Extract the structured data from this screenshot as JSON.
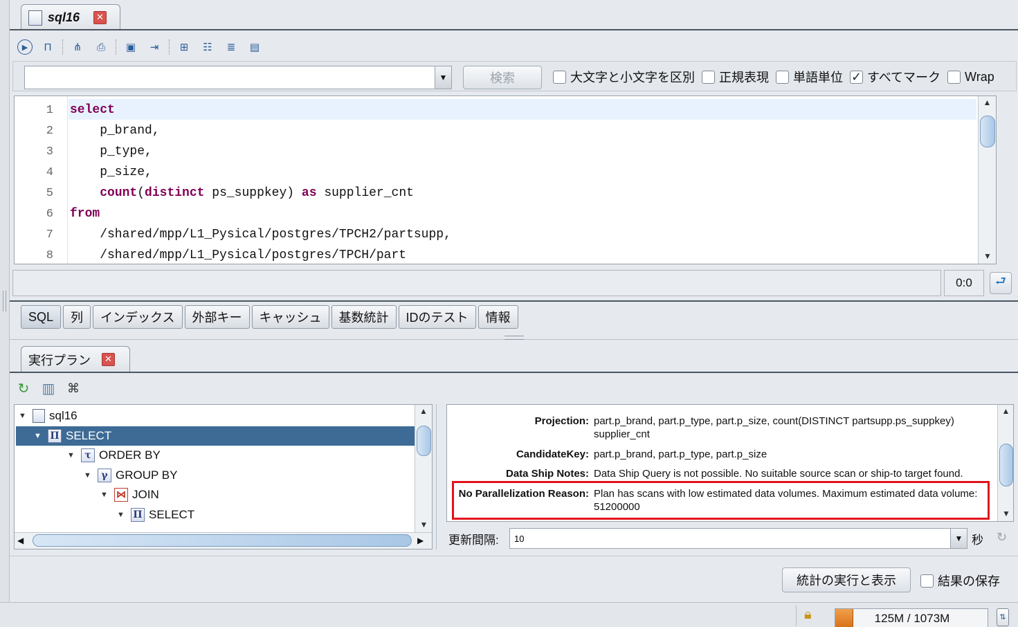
{
  "editor_tab": {
    "title": "sql16",
    "close": "✕"
  },
  "toolbar": {
    "icons": [
      "execute-icon",
      "explain-plan-icon",
      "query-tree-icon",
      "print-icon",
      "save-icon",
      "import-icon",
      "add-row-icon",
      "format-icon",
      "indent-icon",
      "document-icon"
    ]
  },
  "search": {
    "value": "",
    "search_button": "検索",
    "options": [
      {
        "label": "大文字と小文字を区別",
        "checked": false
      },
      {
        "label": "正規表現",
        "checked": false
      },
      {
        "label": "単語単位",
        "checked": false
      },
      {
        "label": "すべてマーク",
        "checked": true
      },
      {
        "label": "Wrap",
        "checked": false
      }
    ],
    "check_mark": "✓"
  },
  "code": {
    "lines": [
      {
        "n": "1",
        "kw": "select",
        "rest": ""
      },
      {
        "n": "2",
        "kw": "",
        "rest": "    p_brand,"
      },
      {
        "n": "3",
        "kw": "",
        "rest": "    p_type,"
      },
      {
        "n": "4",
        "kw": "",
        "rest": "    p_size,"
      },
      {
        "n": "5",
        "kw": "",
        "rest": ""
      },
      {
        "n": "6",
        "kw": "from",
        "rest": ""
      },
      {
        "n": "7",
        "kw": "",
        "rest": "    /shared/mpp/L1_Pysical/postgres/TPCH2/partsupp,"
      },
      {
        "n": "8",
        "kw": "",
        "rest": "    /shared/mpp/L1_Pysical/postgres/TPCH/part"
      }
    ],
    "line5": {
      "indent": "    ",
      "kw1": "count",
      "t1": "(",
      "kw2": "distinct",
      "t2": " ps_suppkey) ",
      "kw3": "as",
      "t3": " supplier_cnt"
    }
  },
  "cursor_position": "0:0",
  "bottom_tabs": [
    "SQL",
    "列",
    "インデックス",
    "外部キー",
    "キャッシュ",
    "基数統計",
    "IDのテスト",
    "情報"
  ],
  "plan_tab": {
    "title": "実行プラン",
    "close": "✕"
  },
  "tree": {
    "nodes": [
      {
        "label": "sql16",
        "icon": "document-icon",
        "glyph": ""
      },
      {
        "label": "SELECT",
        "icon": "select-icon",
        "glyph": "Π"
      },
      {
        "label": "ORDER BY",
        "icon": "order-by-icon",
        "glyph": "τ"
      },
      {
        "label": "GROUP BY",
        "icon": "group-by-icon",
        "glyph": "γ"
      },
      {
        "label": "JOIN",
        "icon": "join-icon",
        "glyph": "⋈"
      },
      {
        "label": "SELECT",
        "icon": "select-icon",
        "glyph": "Π"
      }
    ]
  },
  "properties": [
    {
      "label": "Projection:",
      "value": "part.p_brand, part.p_type, part.p_size, count(DISTINCT partsupp.ps_suppkey) supplier_cnt"
    },
    {
      "label": "CandidateKey:",
      "value": "part.p_brand, part.p_type, part.p_size"
    },
    {
      "label": "Data Ship Notes:",
      "value": "Data Ship Query is not possible. No suitable source scan or ship-to target found."
    },
    {
      "label": "No Parallelization Reason:",
      "value": "Plan has scans with low estimated data volumes. Maximum estimated data volume: 51200000"
    }
  ],
  "refresh": {
    "label": "更新間隔:",
    "value": "10",
    "unit": "秒"
  },
  "actions": {
    "run_stats": "統計の実行と表示",
    "save_results": "結果の保存",
    "save_checked": false
  },
  "memory": {
    "text": "125M / 1073M",
    "used_fraction": 0.116
  }
}
